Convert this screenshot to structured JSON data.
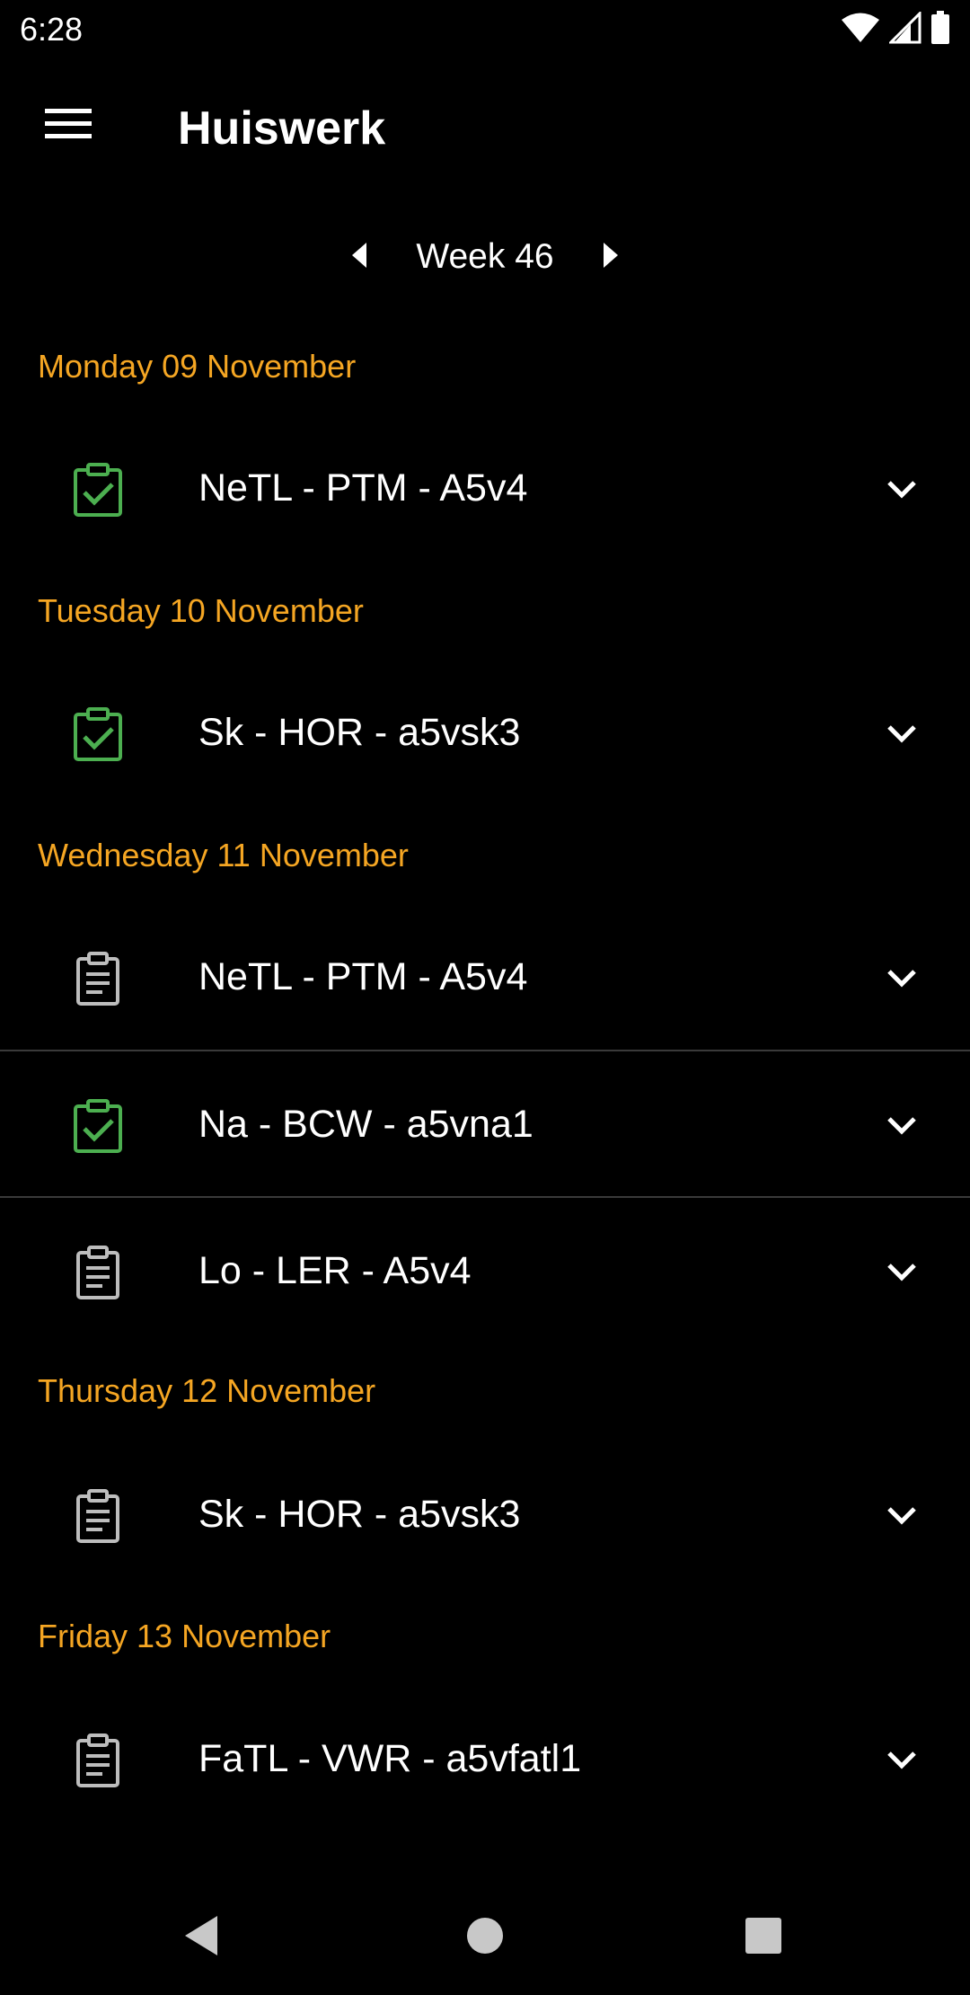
{
  "status_bar": {
    "time": "6:28",
    "icons": [
      "wifi-icon",
      "cell-signal-icon",
      "battery-icon"
    ]
  },
  "app_bar": {
    "menu_icon": "hamburger-menu-icon",
    "title": "Huiswerk"
  },
  "week_selector": {
    "prev_icon": "arrow-left-icon",
    "label": "Week 46",
    "next_icon": "arrow-right-icon"
  },
  "colors": {
    "accent_day_header": "#f5a623",
    "done_icon": "#4caf50",
    "pending_icon": "#bdbdbd",
    "background": "#000000"
  },
  "days": [
    {
      "header": "Monday 09 November",
      "items": [
        {
          "label": "NeTL - PTM - A5v4",
          "status": "done"
        }
      ]
    },
    {
      "header": "Tuesday 10 November",
      "items": [
        {
          "label": "Sk - HOR - a5vsk3",
          "status": "done"
        }
      ]
    },
    {
      "header": "Wednesday 11 November",
      "items": [
        {
          "label": "NeTL - PTM - A5v4",
          "status": "pending"
        },
        {
          "label": "Na - BCW - a5vna1",
          "status": "done"
        },
        {
          "label": "Lo - LER - A5v4",
          "status": "pending"
        }
      ]
    },
    {
      "header": "Thursday 12 November",
      "items": [
        {
          "label": "Sk - HOR - a5vsk3",
          "status": "pending"
        }
      ]
    },
    {
      "header": "Friday 13 November",
      "items": [
        {
          "label": "FaTL - VWR - a5vfatl1",
          "status": "pending"
        }
      ]
    }
  ],
  "nav_bar": {
    "icons": [
      "nav-back-icon",
      "nav-home-icon",
      "nav-recents-icon"
    ]
  }
}
